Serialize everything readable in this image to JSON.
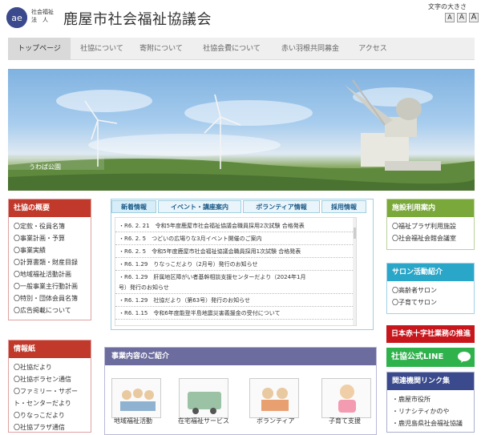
{
  "header": {
    "logo_sub": "社会福祉\n法　人",
    "site_title": "鹿屋市社会福祉協議会",
    "font_size_label": "文字の大きさ",
    "font_sizes": [
      "A",
      "A",
      "A"
    ]
  },
  "nav": {
    "items": [
      "トップページ",
      "社協について",
      "寄附について",
      "社協会費について",
      "赤い羽根共同募金",
      "アクセス"
    ]
  },
  "hero": {
    "caption": "うわば公園"
  },
  "sidebar_left": {
    "overview": {
      "title": "社協の概要",
      "items": [
        "〇定款・役員名簿",
        "〇事業計画・予算",
        "〇事業実績",
        "〇計算書類・財産目録",
        "〇地域福祉活動計画",
        "〇一般事業主行動計画",
        "〇特別・団体会員名簿",
        "〇広告掲載について"
      ]
    },
    "info": {
      "title": "情報紙",
      "items": [
        "〇社協だより",
        "〇社協ボラセン通信",
        "〇ファミリー・サポー",
        "ト・センターだより",
        "〇りなっこだより",
        "〇社協プラザ通信"
      ]
    }
  },
  "center": {
    "tabs": [
      "新着情報",
      "イベント・講座案内",
      "ボランティア情報",
      "採用情報"
    ],
    "news": [
      "・R6. 2. 21　令和5年度鹿屋市社会福祉協議会職員採用2次試験 合格発表",
      "・R6. 2. 5　つどいの広場りな3月イベント開催のご案内",
      "・R6. 2. 5　令和5年度鹿屋市社会福祉協議会職員採用1次試験 合格発表",
      "・R6. 1.29　りなっこだより（2月号）発行のお知らせ",
      "・R6. 1.29　肝属地区障がい者基幹相談支援センターだより（2024年1月",
      "号）発行のお知らせ",
      "・R6. 1.29　社協だより（第63号）発行のお知らせ",
      "・R6. 1.15　令和6年度能登半島地震災害義援金の受付について"
    ]
  },
  "jigyou": {
    "title": "事業内容のご紹介",
    "cards": [
      "地域福祉活動",
      "在宅福祉サービス",
      "ボランティア",
      "子育て支援"
    ]
  },
  "sidebar_right": {
    "facility": {
      "title": "施設利用案内",
      "items": [
        "〇福祉プラザ利用施設",
        "〇社会福祉会館会議室"
      ]
    },
    "salon": {
      "title": "サロン活動紹介",
      "items": [
        "〇高齢者サロン",
        "〇子育てサロン"
      ]
    },
    "redcross": "日本赤十字社業務の推進",
    "line": "社協公式LINE",
    "links": {
      "title": "関連機関リンク集",
      "items": [
        "・鹿屋市役所",
        "・リナシティかのや",
        "・鹿児島県社会福祉協議"
      ]
    }
  },
  "colors": {
    "red": "#c0392b",
    "green": "#7aa83a",
    "teal": "#2aa6c8",
    "navy": "#3a4a8c",
    "purple": "#6c6c9e",
    "line_green": "#2fb24c",
    "redcross": "#c8161d"
  }
}
